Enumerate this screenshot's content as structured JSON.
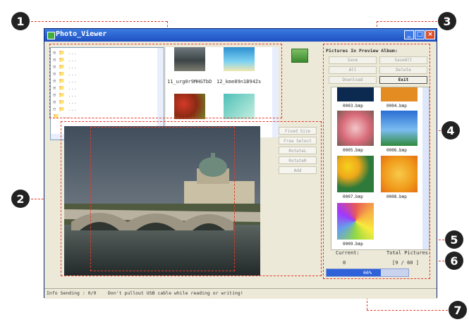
{
  "window": {
    "title": "Photo_Viewer",
    "min_label": "_",
    "max_label": "□",
    "close_label": "×"
  },
  "tree": {
    "rows": [
      "⊞ 📁 ...",
      "⊞ 📁 ...",
      "⊞ 📁 ...",
      "⊞ 📁 ...",
      "⊞ 📁 ...",
      "⊞ 📁 ...",
      "⊞ 📁 ...",
      "⊞ 📁 ...",
      "⊟ 📁 ...",
      "  📁 ..."
    ]
  },
  "thumbnails": [
    {
      "caption": "11_urg0r9MHGTbD"
    },
    {
      "caption": "12_kme89n1B94Zs"
    }
  ],
  "side_buttons": [
    "Fixed Size",
    "Free Select",
    "RotateL",
    "RotateR",
    "Add"
  ],
  "album": {
    "header": "Pictures In Preview Album:",
    "buttons": [
      "Save",
      "SaveAll",
      "All",
      "Delete",
      "Download",
      "Exit"
    ],
    "gallery_captions": [
      "0003.bmp",
      "0004.bmp",
      "0005.bmp",
      "0006.bmp",
      "0007.bmp",
      "0008.bmp",
      "0009.bmp"
    ],
    "current_label": "Current:",
    "current_value": "0",
    "total_label": "Total Pictures:",
    "total_value": "[9 / 60 ]",
    "progress_text": "66%",
    "progress_fraction": 0.66
  },
  "status": {
    "left": "Info Sending :      0/9",
    "right": "Don't pullout USB cable while reading or writing!"
  },
  "callouts": [
    "1",
    "2",
    "3",
    "4",
    "5",
    "6",
    "7"
  ],
  "colors": {
    "annotation": "#e23b2b",
    "titlebar": "#1f4fc2",
    "progress": "#2f62d8"
  }
}
